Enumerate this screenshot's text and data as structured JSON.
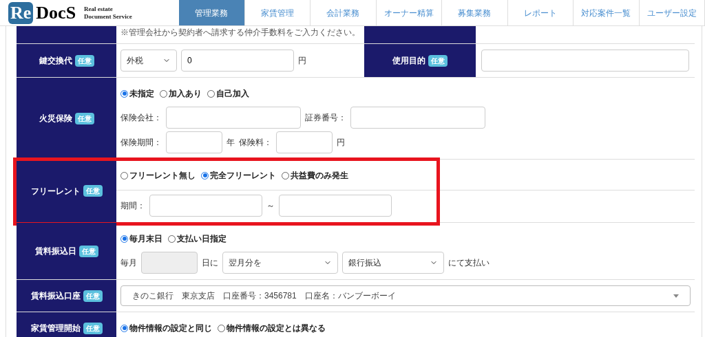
{
  "header": {
    "logo": {
      "mark": "Re",
      "name": "DocS",
      "tagline": [
        "Real estate",
        "Document Service"
      ]
    },
    "nav": [
      {
        "label": "管理業務",
        "selected": true
      },
      {
        "label": "家賃管理",
        "selected": false
      },
      {
        "label": "会計業務",
        "selected": false
      },
      {
        "label": "オーナー精算",
        "selected": false
      },
      {
        "label": "募集業務",
        "selected": false
      },
      {
        "label": "レポート",
        "selected": false
      },
      {
        "label": "対応案件一覧",
        "selected": false
      },
      {
        "label": "ユーザー設定",
        "selected": false
      }
    ]
  },
  "form": {
    "rows": [
      {
        "lines": [
          [
            {
              "kind": "note",
              "text": "※管理会社から契約者へ請求する仲介手数料をご入力ください。"
            }
          ]
        ],
        "side": {}
      },
      {
        "label": "鍵交換代",
        "badge": "任意",
        "lines": [
          [
            {
              "kind": "select",
              "value": "外税"
            },
            {
              "kind": "input",
              "value": "0"
            },
            {
              "kind": "text",
              "text": "円"
            }
          ]
        ],
        "side": {
          "label": "使用目的",
          "badge": "任意",
          "items": [
            {
              "kind": "input"
            }
          ]
        }
      },
      {
        "label": "火災保険",
        "badge": "任意",
        "lines": [
          [
            {
              "kind": "radios",
              "options": [
                {
                  "label": "未指定",
                  "selected": true
                },
                {
                  "label": "加入あり",
                  "selected": false
                },
                {
                  "label": "自己加入",
                  "selected": false
                }
              ]
            }
          ],
          [
            {
              "kind": "text",
              "text": "保険会社："
            },
            {
              "kind": "input"
            },
            {
              "kind": "text",
              "text": "証券番号："
            },
            {
              "kind": "input"
            }
          ],
          [
            {
              "kind": "text",
              "text": "保険期間："
            },
            {
              "kind": "input"
            },
            {
              "kind": "text",
              "text": "年"
            },
            {
              "kind": "text",
              "text": "保険料："
            },
            {
              "kind": "input"
            },
            {
              "kind": "text",
              "text": "円"
            }
          ]
        ]
      },
      {
        "label": "フリーレント",
        "badge": "任意",
        "divided": true,
        "highlighted": true,
        "lines": [
          [
            {
              "kind": "radios",
              "options": [
                {
                  "label": "フリーレント無し",
                  "selected": false
                },
                {
                  "label": "完全フリーレント",
                  "selected": true
                },
                {
                  "label": "共益費のみ発生",
                  "selected": false
                }
              ]
            }
          ],
          [
            {
              "kind": "text",
              "text": "期間："
            },
            {
              "kind": "input"
            },
            {
              "kind": "text",
              "text": "～"
            },
            {
              "kind": "input"
            }
          ]
        ]
      },
      {
        "label": "賃料振込日",
        "badge": "任意",
        "lines": [
          [
            {
              "kind": "radios",
              "options": [
                {
                  "label": "毎月末日",
                  "selected": true
                },
                {
                  "label": "支払い日指定",
                  "selected": false
                }
              ]
            }
          ],
          [
            {
              "kind": "text",
              "text": "毎月"
            },
            {
              "kind": "input",
              "disabled": true
            },
            {
              "kind": "text",
              "text": "日に"
            },
            {
              "kind": "select",
              "value": "翌月分を"
            },
            {
              "kind": "select",
              "value": "銀行振込"
            },
            {
              "kind": "text",
              "text": "にて支払い"
            }
          ]
        ]
      },
      {
        "label": "賃料振込口座",
        "badge": "任意",
        "lines": [
          [
            {
              "kind": "dropdown",
              "value": "きのこ銀行　東京支店　口座番号：3456781　口座名：バンブーボーイ"
            }
          ]
        ]
      },
      {
        "label": "家賃管理開始",
        "badge": "任意",
        "lines": [
          [
            {
              "kind": "radios",
              "options": [
                {
                  "label": "物件情報の設定と同じ",
                  "selected": true
                },
                {
                  "label": "物件情報の設定とは異なる",
                  "selected": false
                }
              ]
            }
          ]
        ]
      }
    ]
  }
}
